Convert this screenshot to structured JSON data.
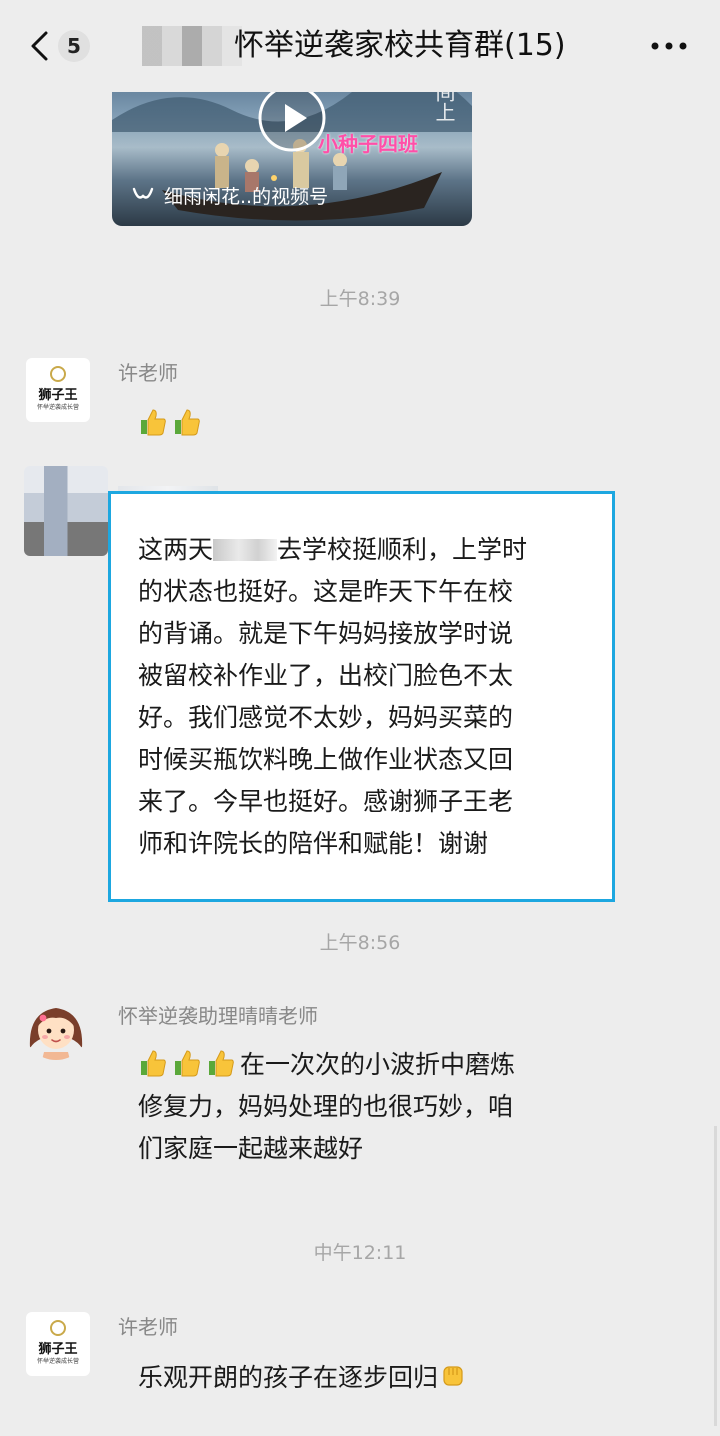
{
  "header": {
    "unread_count": "5",
    "title": "怀举逆袭家校共育群(15)"
  },
  "video_card": {
    "overlay_text": "小种子四班",
    "corner_text": "间上",
    "source_label": "细雨闲花..的视频号"
  },
  "timestamps": [
    "上午8:39",
    "上午8:56",
    "中午12:11"
  ],
  "messages": [
    {
      "sender": "许老师",
      "avatar_text": "狮子王",
      "avatar_subtext": "怀举逆袭成长营",
      "emojis": [
        "thumbs-up",
        "thumbs-up"
      ]
    },
    {
      "sender": "",
      "lines": [
        {
          "before": "这两天",
          "after": "去学校挺顺利，上学时"
        },
        "的状态也挺好。这是昨天下午在校",
        "的背诵。就是下午妈妈接放学时说",
        "被留校补作业了，出校门脸色不太",
        "好。我们感觉不太妙，妈妈买菜的",
        "时候买瓶饮料晚上做作业状态又回",
        "来了。今早也挺好。感谢狮子王老",
        "师和许院长的陪伴和赋能！谢谢"
      ]
    },
    {
      "sender": "怀举逆袭助理晴晴老师",
      "emojis": [
        "thumbs-up",
        "thumbs-up",
        "thumbs-up"
      ],
      "lines": [
        "在一次次的小波折中磨炼",
        "修复力，妈妈处理的也很巧妙，咱",
        "们家庭一起越来越好"
      ]
    },
    {
      "sender": "许老师",
      "avatar_text": "狮子王",
      "avatar_subtext": "怀举逆袭成长营",
      "text": "乐观开朗的孩子在逐步回归",
      "emojis": [
        "fist"
      ]
    }
  ],
  "colors": {
    "background": "#ededed",
    "highlight_border": "#1da7e0",
    "timestamp": "#a6a6a6",
    "sender": "#888888"
  }
}
